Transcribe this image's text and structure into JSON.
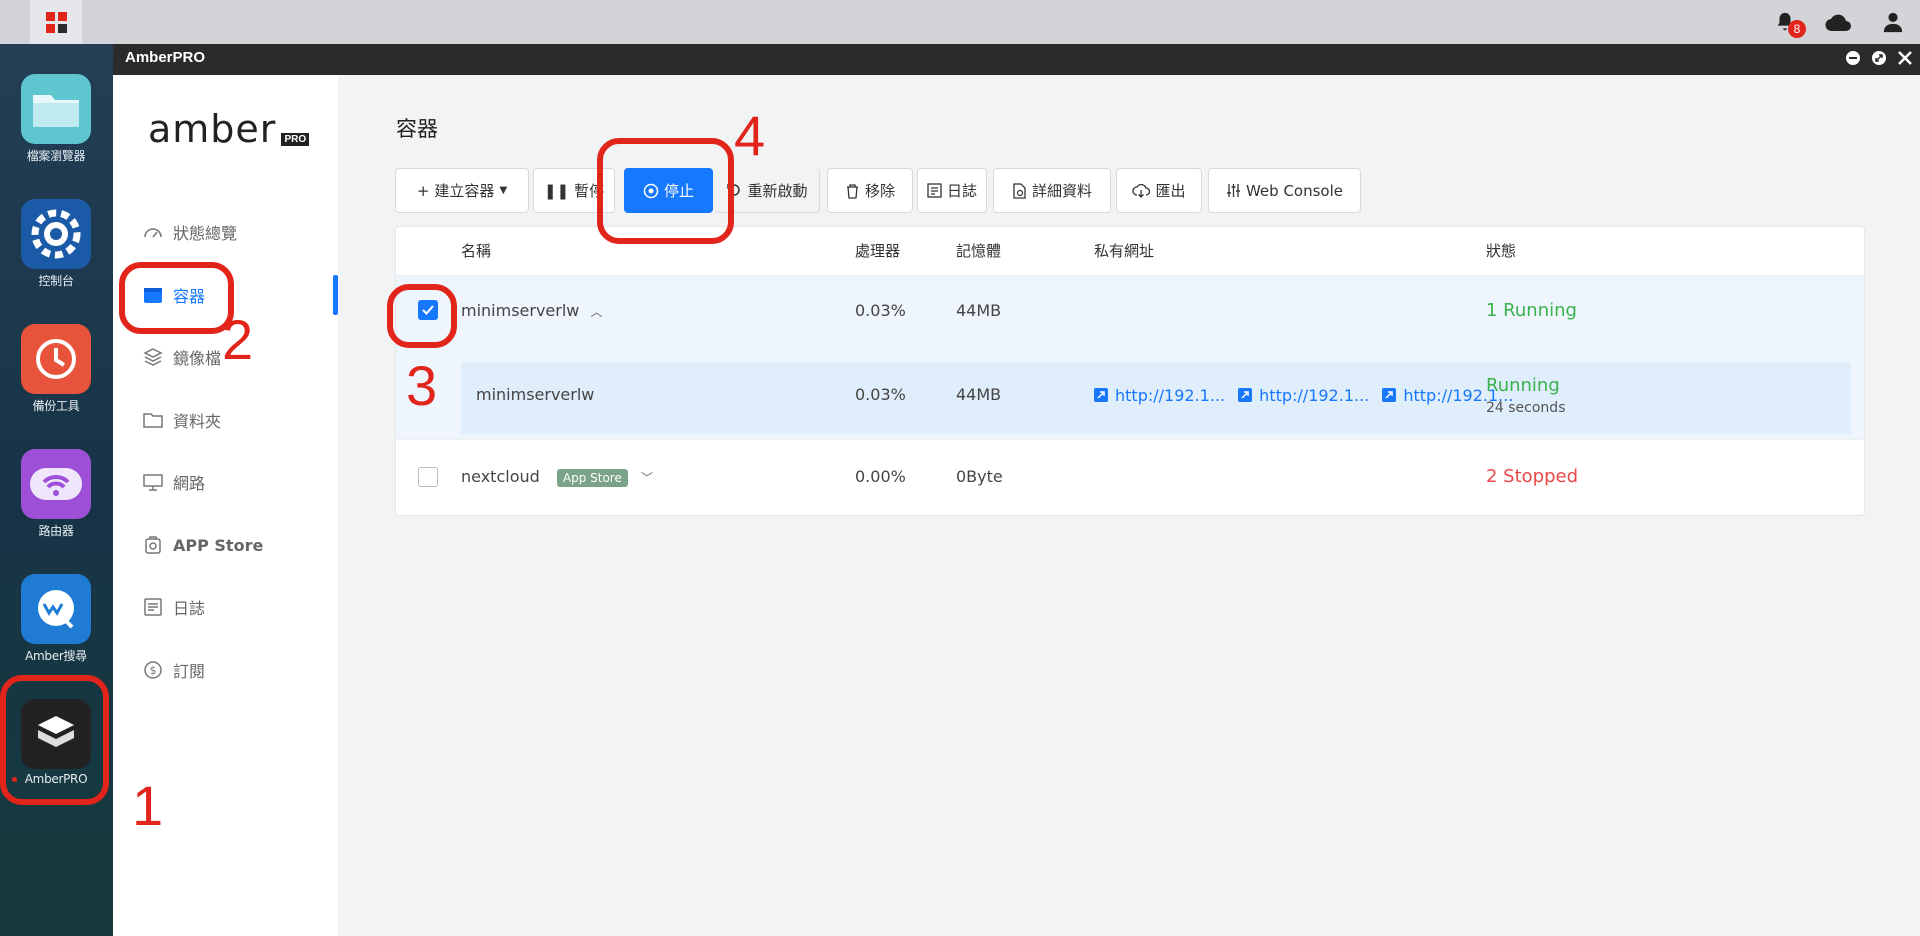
{
  "taskbar": {
    "notification_count": "8",
    "start_colors": [
      "#e1251b",
      "#e1251b",
      "#e1251b",
      "#2b2b2b"
    ]
  },
  "dock": {
    "items": [
      {
        "label": "檔案瀏覽器",
        "icon": "folder-icon",
        "color": "#5fc6cf"
      },
      {
        "label": "控制台",
        "icon": "gear-icon",
        "color": "#1b5aa6"
      },
      {
        "label": "備份工具",
        "icon": "backup-clock-icon",
        "color": "#e8543b"
      },
      {
        "label": "路由器",
        "icon": "wifi-router-icon",
        "color": "#9d4fd6"
      },
      {
        "label": "Amber搜尋",
        "icon": "search-chat-icon",
        "color": "#1f7bd4"
      },
      {
        "label": "AmberPRO",
        "icon": "box-icon",
        "color": "#222222"
      }
    ]
  },
  "window": {
    "title": "AmberPRO"
  },
  "sidebar": {
    "logo_text": "amber",
    "logo_badge": "PRO",
    "items": [
      {
        "label": "狀態總覽",
        "icon": "dashboard-icon"
      },
      {
        "label": "容器",
        "icon": "container-icon"
      },
      {
        "label": "鏡像檔",
        "icon": "layers-icon"
      },
      {
        "label": "資料夾",
        "icon": "folder-outline-icon"
      },
      {
        "label": "網路",
        "icon": "monitor-icon"
      },
      {
        "label": "APP Store",
        "icon": "app-store-icon"
      },
      {
        "label": "日誌",
        "icon": "log-icon"
      },
      {
        "label": "訂閱",
        "icon": "dollar-icon"
      }
    ]
  },
  "main": {
    "title": "容器",
    "toolbar": {
      "create": "建立容器",
      "pause": "暫停",
      "stop": "停止",
      "restart": "重新啟動",
      "remove": "移除",
      "log": "日誌",
      "details": "詳細資料",
      "export": "匯出",
      "console": "Web Console"
    },
    "table": {
      "headers": {
        "name": "名稱",
        "cpu": "處理器",
        "memory": "記憶體",
        "address": "私有網址",
        "status": "狀態"
      },
      "rows": [
        {
          "name": "minimserverlw",
          "cpu": "0.03%",
          "memory": "44MB",
          "status": "1 Running"
        },
        {
          "name": "minimserverlw",
          "cpu": "0.03%",
          "memory": "44MB",
          "links": [
            "http://192.1...",
            "http://192.1...",
            "http://192.1..."
          ],
          "status": "Running",
          "status_sub": "24 seconds"
        },
        {
          "name": "nextcloud",
          "tag": "App Store",
          "cpu": "0.00%",
          "memory": "0Byte",
          "status": "2 Stopped"
        }
      ]
    }
  },
  "annotations": [
    "1",
    "2",
    "3",
    "4"
  ],
  "colors": {
    "accent": "#1677ff",
    "running": "#3ab24e",
    "stopped": "#e94848",
    "annotation": "#e1251b"
  }
}
